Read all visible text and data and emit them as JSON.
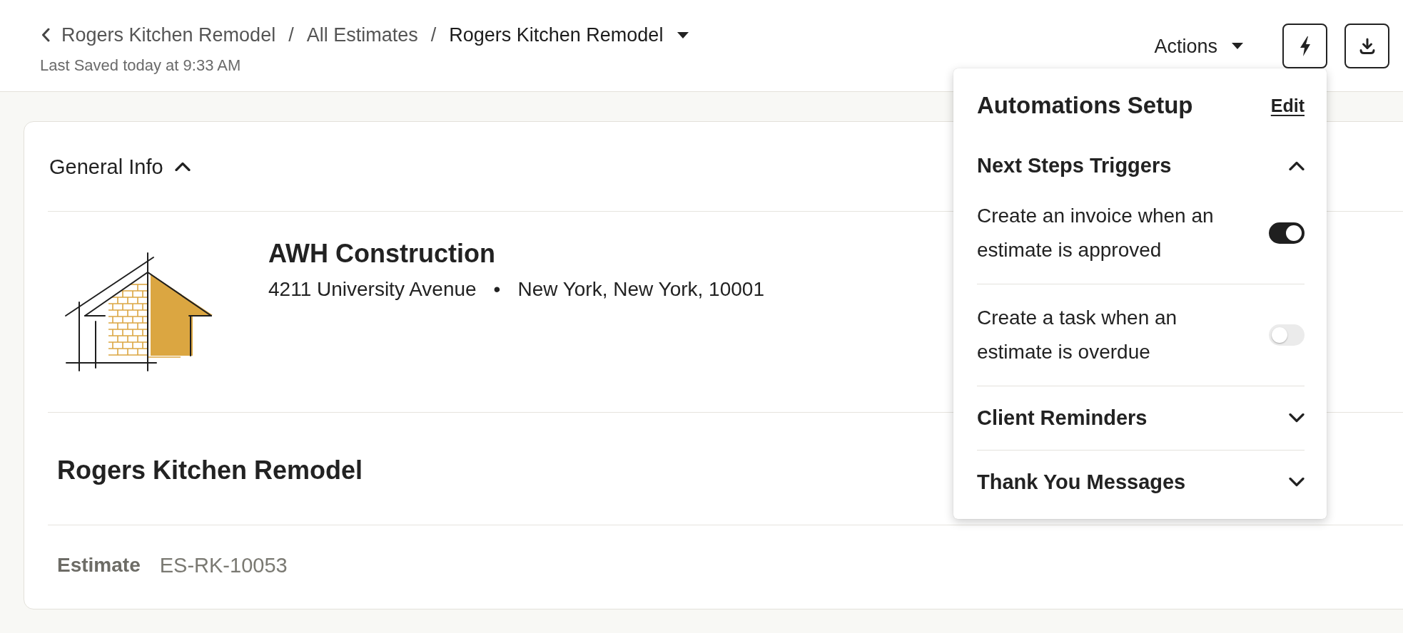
{
  "breadcrumb": [
    {
      "label": "Rogers Kitchen Remodel",
      "current": false
    },
    {
      "separator": "/",
      "label": "All Estimates",
      "current": false
    },
    {
      "separator": "/",
      "label": "Rogers Kitchen Remodel",
      "current": true
    }
  ],
  "last_saved": "Last Saved today at 9:33 AM",
  "actions_menu": {
    "label": "Actions"
  },
  "toolbar_buttons": [
    {
      "kind": "lightning"
    },
    {
      "kind": "download"
    }
  ],
  "general_info": {
    "title": "General Info",
    "expanded": true,
    "company": {
      "name": "AWH Construction",
      "street": "4211 University Avenue",
      "separator": "•",
      "city": "New York, New York, 10001"
    },
    "project_title": "Rogers Kitchen Remodel",
    "fields": [
      {
        "label": "Estimate",
        "value": "ES-RK-10053"
      }
    ]
  },
  "automations_popover": {
    "title": "Automations Setup",
    "edit_link": "Edit",
    "sections": [
      {
        "title": "Next Steps Triggers",
        "expanded": true,
        "items": [
          {
            "label": "Create an invoice when an estimate is approved",
            "on": true
          },
          {
            "label": "Create a task when an estimate is overdue",
            "on": false
          }
        ]
      },
      {
        "title": "Client Reminders",
        "expanded": false
      },
      {
        "title": "Thank You Messages",
        "expanded": false
      }
    ]
  }
}
